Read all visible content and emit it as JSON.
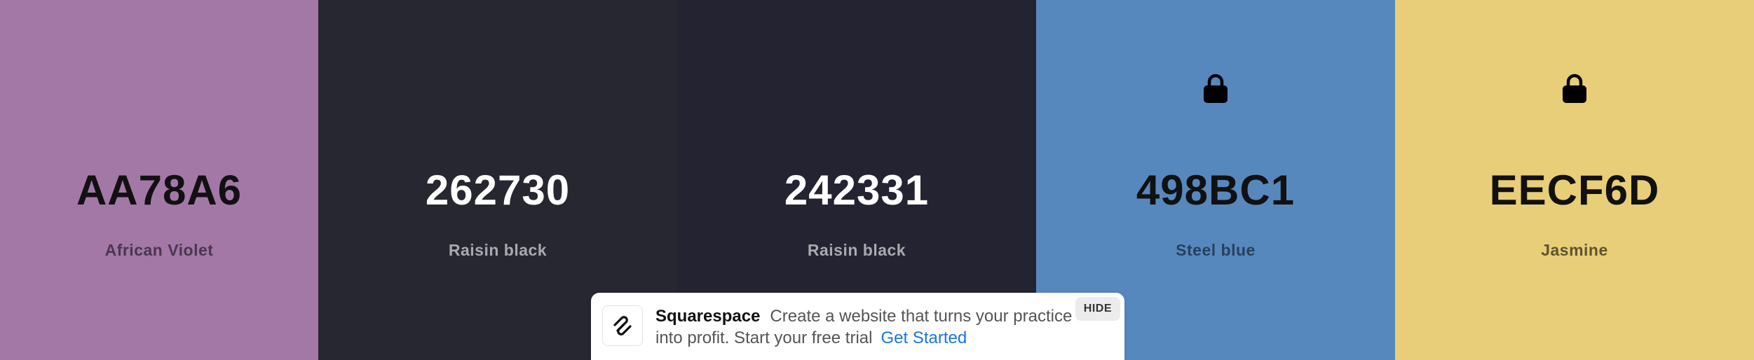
{
  "swatches": [
    {
      "hex": "AA78A6",
      "name": "African Violet",
      "color": "#A378A6",
      "text_color": "#111111",
      "name_color": "#4a3650",
      "locked": false
    },
    {
      "hex": "262730",
      "name": "Raisin black",
      "color": "#262730",
      "text_color": "#ffffff",
      "name_color": "#a9a9b0",
      "locked": false
    },
    {
      "hex": "242331",
      "name": "Raisin black",
      "color": "#242331",
      "text_color": "#ffffff",
      "name_color": "#a9a9b0",
      "locked": false
    },
    {
      "hex": "498BC1",
      "name": "Steel blue",
      "color": "#5788BD",
      "text_color": "#111111",
      "name_color": "#27415c",
      "locked": true
    },
    {
      "hex": "EECF6D",
      "name": "Jasmine",
      "color": "#E8CE78",
      "text_color": "#111111",
      "name_color": "#5e5430",
      "locked": true
    }
  ],
  "ad": {
    "brand": "Squarespace",
    "message": "Create a website that turns your practice into profit. Start your free trial",
    "cta": "Get Started",
    "hide_label": "HIDE"
  },
  "icons": {
    "lock": "lock-icon",
    "logo": "squarespace-logo-icon"
  }
}
